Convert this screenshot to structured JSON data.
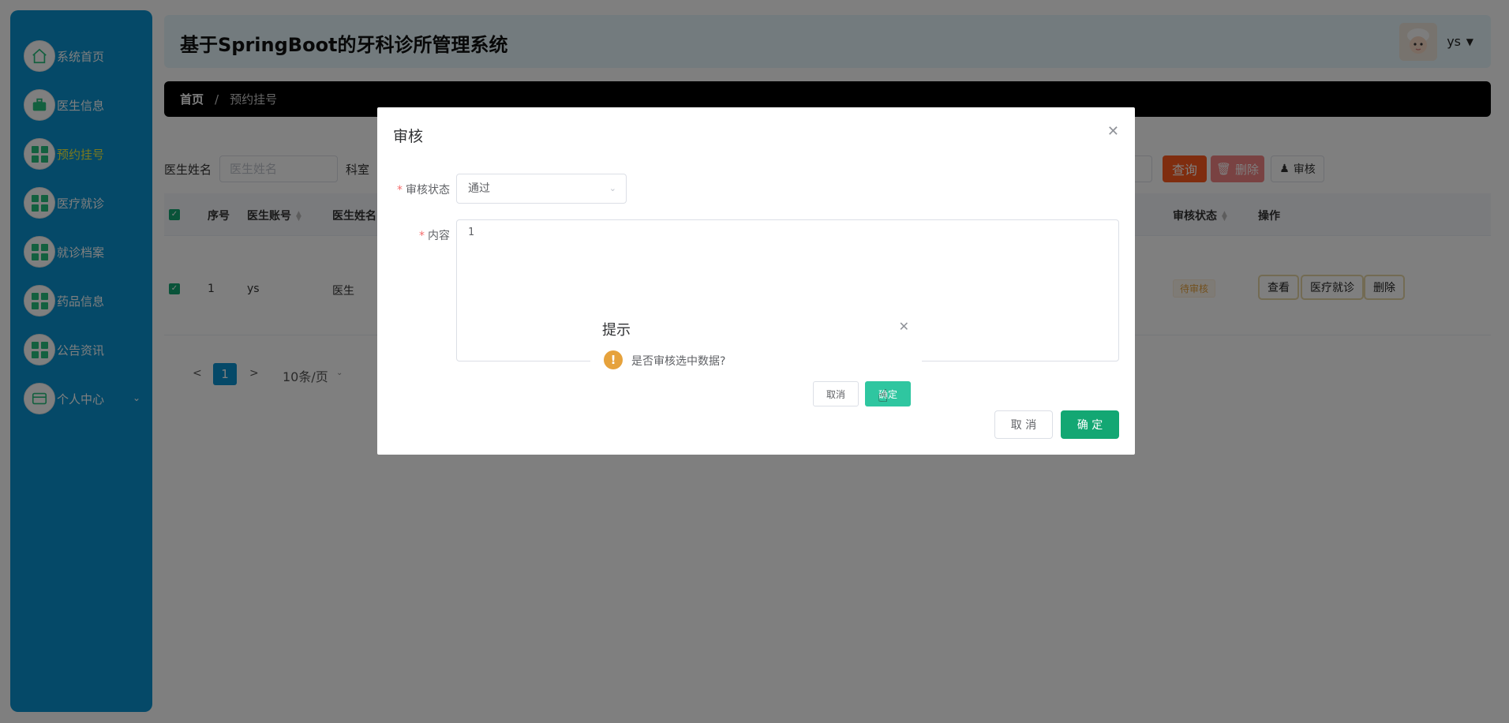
{
  "sidebar": {
    "items": [
      {
        "label": "系统首页",
        "icon": "home-icon"
      },
      {
        "label": "医生信息",
        "icon": "briefcase-icon"
      },
      {
        "label": "预约挂号",
        "icon": "grid-icon",
        "active": true
      },
      {
        "label": "医疗就诊",
        "icon": "grid-icon"
      },
      {
        "label": "就诊档案",
        "icon": "grid-icon"
      },
      {
        "label": "药品信息",
        "icon": "grid-icon"
      },
      {
        "label": "公告资讯",
        "icon": "grid-icon"
      },
      {
        "label": "个人中心",
        "icon": "wallet-icon"
      }
    ],
    "bg_color": "#0a93d0",
    "active_color": "#f4f23d"
  },
  "header": {
    "title": "基于SpringBoot的牙科诊所管理系统",
    "user": "ys"
  },
  "breadcrumb": {
    "home": "首页",
    "separator": "/",
    "current": "预约挂号"
  },
  "search": {
    "doctor_name_label": "医生姓名",
    "doctor_name_placeholder": "医生姓名",
    "department_label": "科室",
    "query_label": "查询",
    "delete_label": "删除",
    "audit_label": "审核"
  },
  "table": {
    "columns": [
      "序号",
      "医生账号",
      "医生姓名",
      "审核状态",
      "操作"
    ],
    "rows": [
      {
        "index": "1",
        "doctor_account": "ys",
        "doctor_name": "医生",
        "status": "待审核",
        "actions": [
          "查看",
          "医疗就诊",
          "删除"
        ]
      }
    ]
  },
  "pagination": {
    "prev": "<",
    "current_page": "1",
    "next": ">",
    "page_size": "10条/页"
  },
  "audit_dialog": {
    "title": "审核",
    "status_label": "审核状态",
    "status_value": "通过",
    "content_label": "内容",
    "content_value": "1",
    "cancel_label": "取 消",
    "confirm_label": "确 定"
  },
  "confirm_dialog": {
    "title": "提示",
    "message": "是否审核选中数据?",
    "cancel_label": "取消",
    "confirm_label": "确定"
  },
  "colors": {
    "primary_green": "#13a773",
    "query_orange": "#ff5a1f",
    "delete_pink": "#f38585",
    "warn": "#e6a23c"
  }
}
